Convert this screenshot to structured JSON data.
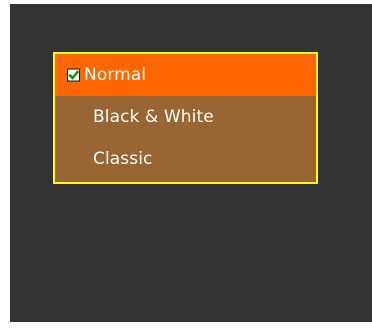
{
  "colors": {
    "screen_bg": "#333333",
    "menu_bg": "#996633",
    "menu_border": "#ffff00",
    "selected_bg": "#ff6600",
    "text": "#ffffff",
    "check": "#009900"
  },
  "menu": {
    "items": [
      {
        "label": "Normal",
        "selected": true,
        "icon": "checkbox-checked-icon"
      },
      {
        "label": "Black & White",
        "selected": false
      },
      {
        "label": "Classic",
        "selected": false
      }
    ]
  }
}
